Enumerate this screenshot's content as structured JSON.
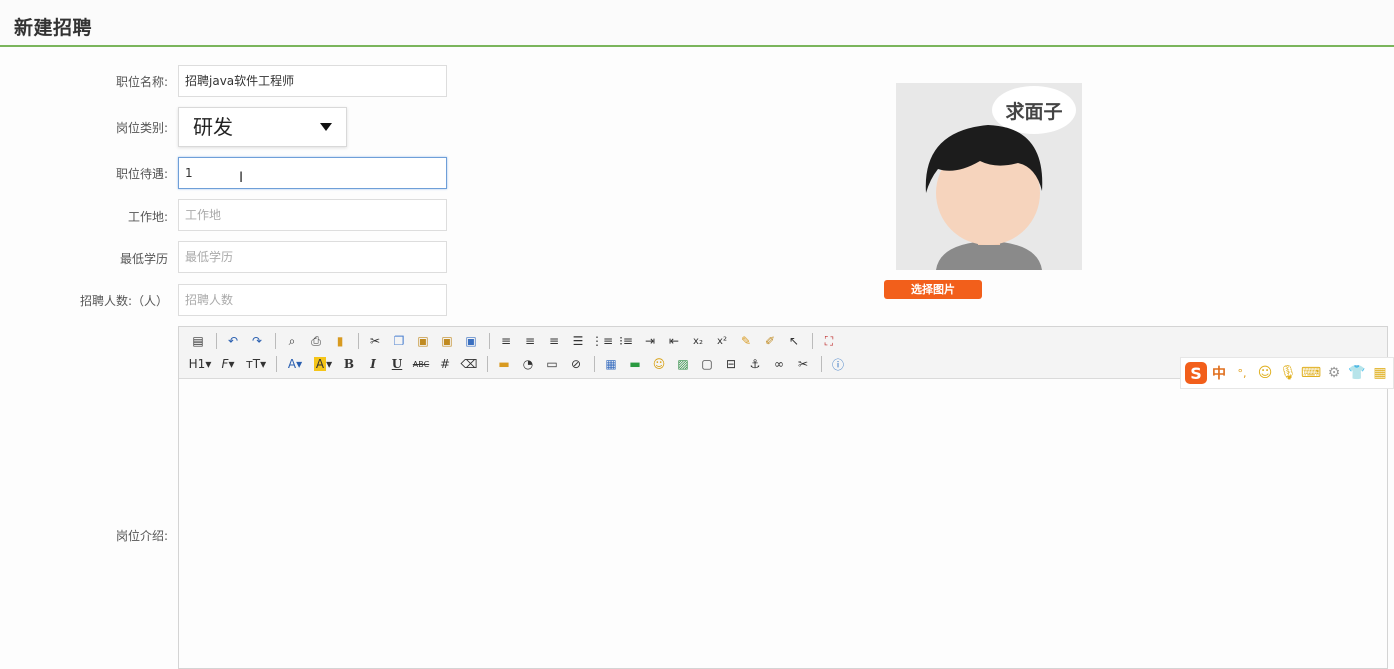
{
  "header": {
    "title": "新建招聘"
  },
  "form": {
    "job_name": {
      "label": "职位名称:",
      "value": "招聘java软件工程师"
    },
    "category": {
      "label": "岗位类别:",
      "value": "研发"
    },
    "salary": {
      "label": "职位待遇:",
      "value": "1"
    },
    "location": {
      "label": "工作地:",
      "placeholder": "工作地"
    },
    "education": {
      "label": "最低学历",
      "placeholder": "最低学历"
    },
    "headcount": {
      "label": "招聘人数:（人）",
      "placeholder": "招聘人数"
    },
    "intro": {
      "label": "岗位介绍:"
    }
  },
  "avatar": {
    "bubble_text": "求面子"
  },
  "buttons": {
    "pick_image": "选择图片"
  },
  "toolbar": {
    "row1": [
      "source-icon",
      "undo-icon",
      "redo-icon",
      "preview-icon",
      "print-icon",
      "template-icon",
      "cut-icon",
      "copy-icon",
      "paste-icon",
      "paste-text-icon",
      "paste-word-icon",
      "align-left-icon",
      "align-center-icon",
      "align-right-icon",
      "justify-icon",
      "ordered-list-icon",
      "unordered-list-icon",
      "indent-icon",
      "outdent-icon",
      "subscript-icon",
      "superscript-icon",
      "clear-format-icon",
      "select-all-icon",
      "cursor-icon",
      "fullscreen-icon"
    ],
    "row2_labels": {
      "heading": "H1",
      "font": "F",
      "fontsize": "тT",
      "forecolor": "A",
      "hilite": "A",
      "bold": "B",
      "italic": "I",
      "underline": "U",
      "strike": "ABC"
    }
  },
  "ime": {
    "lang": "中",
    "punct": "°,"
  },
  "colors": {
    "accent_green": "#7ab55c",
    "button_orange": "#f25f1b",
    "focus_blue": "#6f9fd8"
  }
}
